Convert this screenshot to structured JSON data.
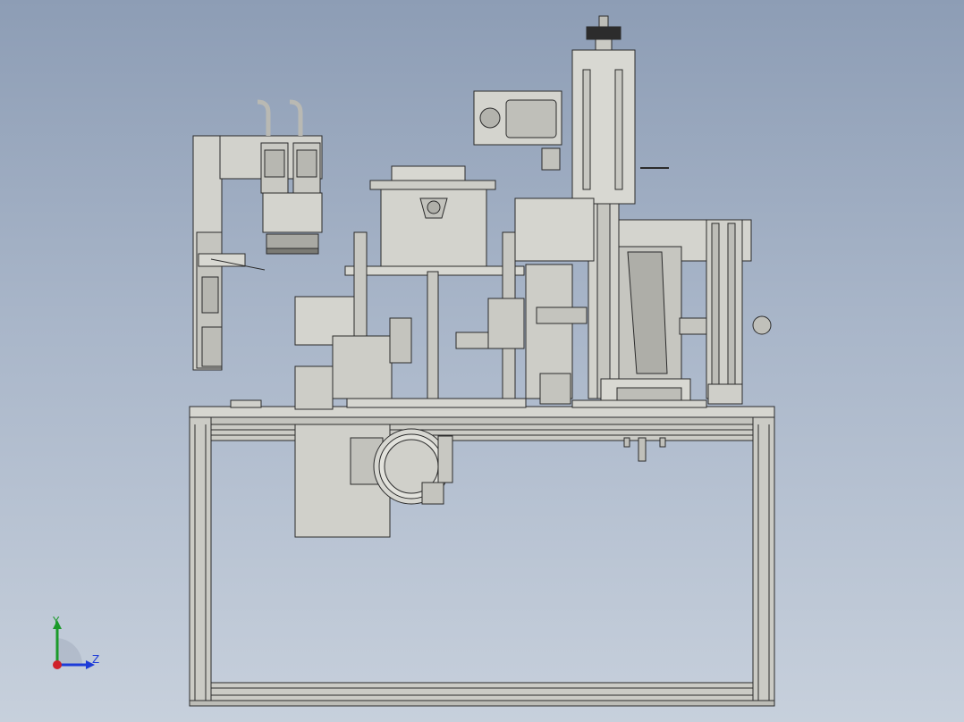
{
  "viewport": {
    "background_top": "#8d9db5",
    "background_bottom": "#c7d0dc"
  },
  "triad": {
    "y_label": "Y",
    "z_label": "Z",
    "y_color": "#1b9a2a",
    "z_color": "#1d3bd8",
    "x_color": "#d0202a"
  },
  "colors": {
    "part_fill": "#cfcfc9",
    "part_fill_light": "#dcdcd6",
    "part_fill_dark": "#a6a6a0",
    "edge": "#2b2b2b"
  }
}
